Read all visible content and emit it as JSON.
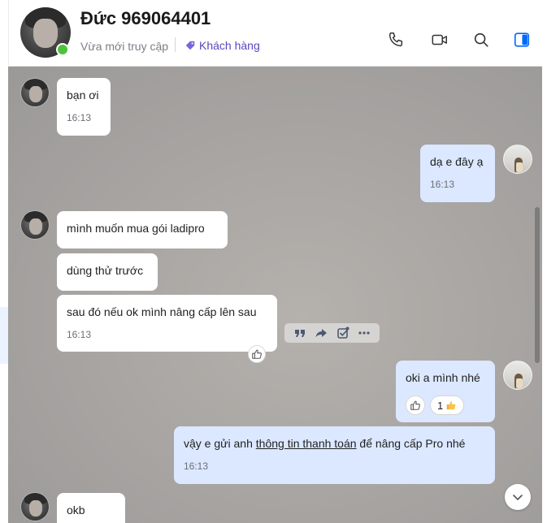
{
  "header": {
    "contact_name": "Đức 969064401",
    "status": "Vừa mới truy cập",
    "tag_label": "Khách hàng",
    "icons": [
      "phone-icon",
      "video-call-icon",
      "search-icon",
      "sidebar-toggle-icon"
    ],
    "accent_color": "#0068ff",
    "tag_color": "#5b45c2",
    "online_color": "#4bc43b"
  },
  "messages": [
    {
      "from": "contact",
      "text": "bạn ơi",
      "time": "16:13"
    },
    {
      "from": "me",
      "text": "dạ e đây ạ",
      "time": "16:13"
    },
    {
      "from": "contact",
      "text": "mình muốn mua gói ladipro"
    },
    {
      "from": "contact",
      "text": "dùng thử trước"
    },
    {
      "from": "contact",
      "text": "sau đó nếu ok mình nâng cấp lên sau",
      "time": "16:13"
    },
    {
      "from": "me",
      "text": "oki a mình nhé",
      "reaction_count": "1"
    },
    {
      "from": "me",
      "text_before": "vậy e gửi anh ",
      "link_text": "thông tin thanh toán",
      "text_after": " để nâng cấp Pro nhé",
      "time": "16:13"
    },
    {
      "from": "contact",
      "text": "okb"
    }
  ],
  "message_actions": [
    "quote-icon",
    "forward-icon",
    "select-message-icon",
    "more-icon"
  ]
}
